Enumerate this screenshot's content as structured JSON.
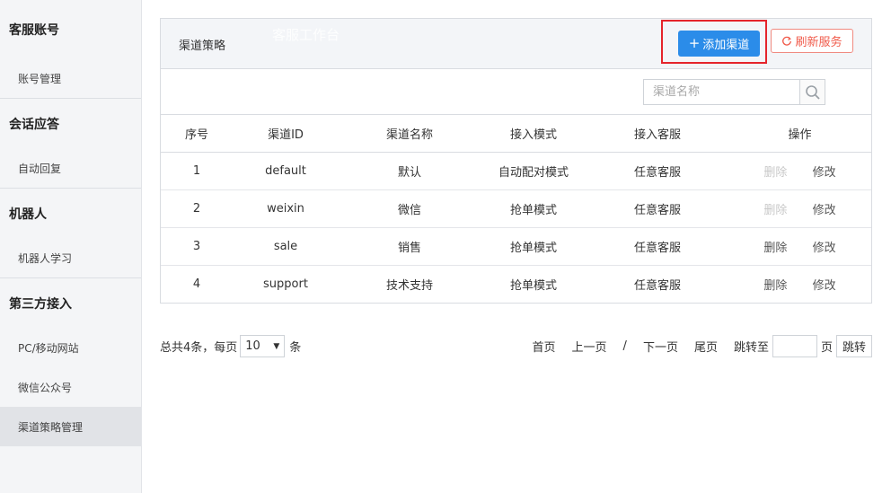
{
  "sidebar": {
    "groups": [
      {
        "title": "客服账号",
        "items": [
          "账号管理"
        ]
      },
      {
        "title": "会话应答",
        "items": [
          "自动回复"
        ]
      },
      {
        "title": "机器人",
        "items": [
          "机器人学习"
        ]
      },
      {
        "title": "第三方接入",
        "items": [
          "PC/移动网站",
          "微信公众号",
          "渠道策略管理"
        ]
      }
    ]
  },
  "panel": {
    "title": "渠道策略",
    "watermark": "客服工作台",
    "add_button": "添加渠道",
    "refresh_button": "刷新服务"
  },
  "search": {
    "placeholder": "渠道名称"
  },
  "table": {
    "headers": [
      "序号",
      "渠道ID",
      "渠道名称",
      "接入模式",
      "接入客服",
      "操作"
    ],
    "rows": [
      {
        "idx": "1",
        "id": "default",
        "name": "默认",
        "mode": "自动配对模式",
        "agent": "任意客服",
        "delete": "删除",
        "edit": "修改"
      },
      {
        "idx": "2",
        "id": "weixin",
        "name": "微信",
        "mode": "抢单模式",
        "agent": "任意客服",
        "delete": "删除",
        "edit": "修改"
      },
      {
        "idx": "3",
        "id": "sale",
        "name": "销售",
        "mode": "抢单模式",
        "agent": "任意客服",
        "delete": "删除",
        "edit": "修改"
      },
      {
        "idx": "4",
        "id": "support",
        "name": "技术支持",
        "mode": "抢单模式",
        "agent": "任意客服",
        "delete": "删除",
        "edit": "修改"
      }
    ]
  },
  "pager": {
    "total_prefix": "总共4条，每页",
    "page_size": "10",
    "unit": "条",
    "first": "首页",
    "prev": "上一页",
    "sep": "/",
    "next": "下一页",
    "last": "尾页",
    "jump_to": "跳转至",
    "page": "页",
    "jump_button": "跳转"
  },
  "colors": {
    "primary": "#2b8ce9",
    "danger": "#f05a4a",
    "highlight": "#e5242b"
  }
}
